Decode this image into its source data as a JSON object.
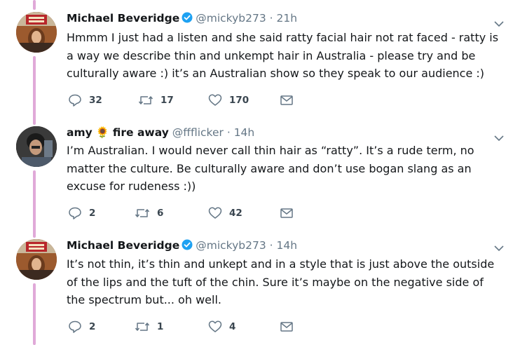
{
  "tweets": [
    {
      "name": "Michael Beveridge",
      "handle": "@mickyb273",
      "sep": "·",
      "time": "21h",
      "verified": true,
      "avatar": "avatar-photo",
      "text": "Hmmm I just had a listen and she said ratty facial hair not rat faced - ratty is a way we describe thin and unkempt hair in Australia - please try and be culturally aware :) it’s an Australian show so they speak to our audience :)",
      "replies": "32",
      "retweets": "17",
      "likes": "170"
    },
    {
      "name": "amy",
      "name_emoji": "🌻",
      "name_suffix": "fire away",
      "handle": "@ffflicker",
      "sep": "·",
      "time": "14h",
      "verified": false,
      "avatar": "avatar-photo",
      "text": "I’m Australian. I would never call thin hair as “ratty”. It’s a rude term, no matter the culture. Be culturally aware and don’t use bogan slang as an excuse for rudeness :))",
      "replies": "2",
      "retweets": "6",
      "likes": "42"
    },
    {
      "name": "Michael Beveridge",
      "handle": "@mickyb273",
      "sep": "·",
      "time": "14h",
      "verified": true,
      "avatar": "avatar-photo",
      "text": "It’s not thin, it’s thin and unkept and in a style that is just above the outside of the lips and the tuft of the chin. Sure it’s maybe on the negative side of the spectrum but... oh well.",
      "replies": "2",
      "retweets": "1",
      "likes": "4"
    }
  ],
  "icons": [
    "reply-icon",
    "retweet-icon",
    "like-icon",
    "direct-message-icon",
    "verified-icon",
    "chevron-down-icon"
  ],
  "colors": {
    "thread_line": "#e0a9d8",
    "verified": "#1da1f2",
    "meta": "#657786",
    "text": "#14171a"
  }
}
